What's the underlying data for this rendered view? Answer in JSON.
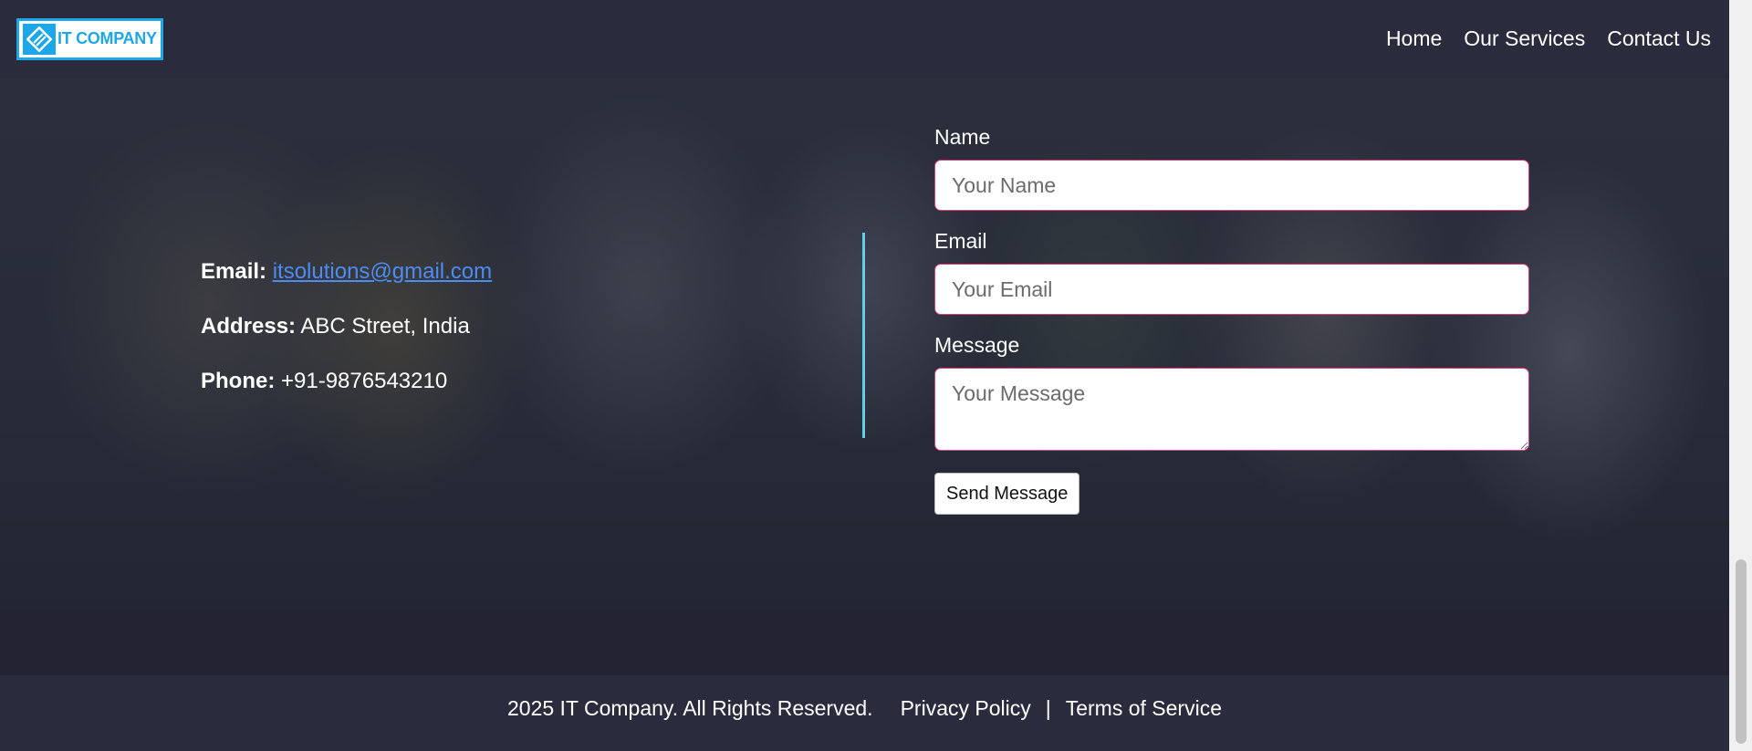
{
  "header": {
    "logo_text": "IT COMPANY",
    "nav": [
      {
        "label": "Home"
      },
      {
        "label": "Our Services"
      },
      {
        "label": "Contact Us"
      }
    ]
  },
  "contact": {
    "email_label": "Email:",
    "email_value": "itsolutions@gmail.com",
    "address_label": "Address:",
    "address_value": "ABC Street, India",
    "phone_label": "Phone:",
    "phone_value": "+91-9876543210"
  },
  "form": {
    "name_label": "Name",
    "name_placeholder": "Your Name",
    "email_label": "Email",
    "email_placeholder": "Your Email",
    "message_label": "Message",
    "message_placeholder": "Your Message",
    "submit_label": "Send Message"
  },
  "footer": {
    "copyright": "2025 IT Company. All Rights Reserved.",
    "privacy": "Privacy Policy",
    "separator": "|",
    "terms": "Terms of Service"
  },
  "colors": {
    "accent": "#1ea7e8",
    "divider": "#5fd0e8",
    "link": "#4b8cf5",
    "input_border": "#d6407d",
    "header_bg": "#2a2b3c"
  }
}
